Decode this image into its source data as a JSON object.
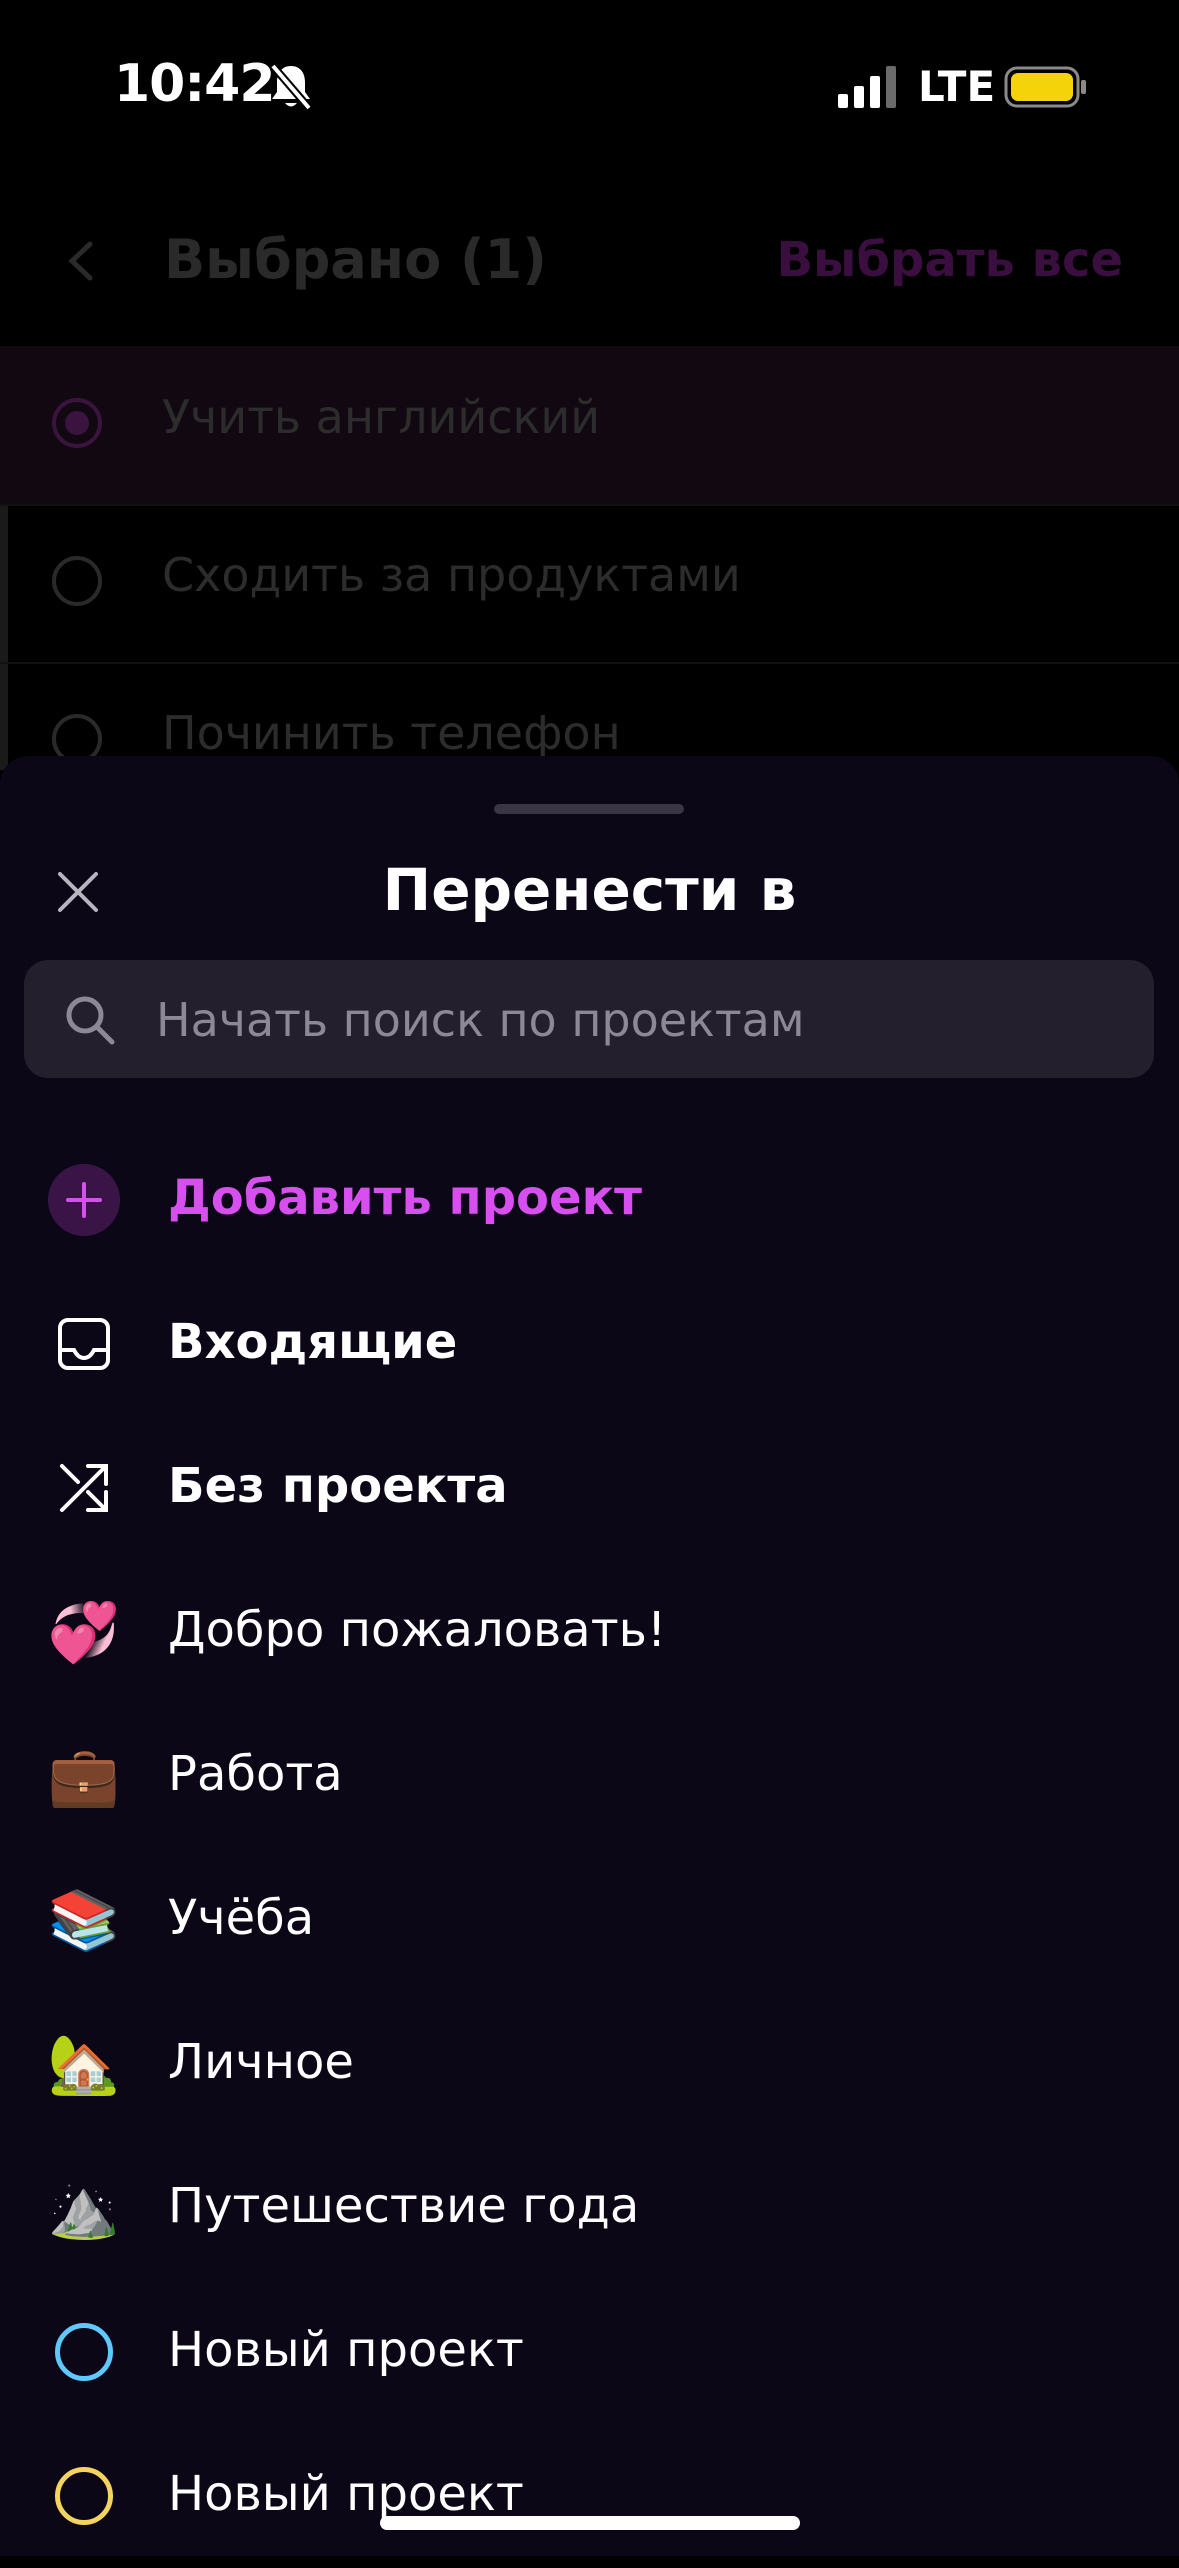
{
  "status_bar": {
    "time": "10:42",
    "network": "LTE",
    "icons": [
      "bell-slash-icon",
      "signal-icon",
      "battery-icon"
    ],
    "battery_color": "#f5d30a"
  },
  "background": {
    "title": "Выбрано (1)",
    "select_all": "Выбрать все",
    "tasks": [
      {
        "text": "Учить английский",
        "selected": true
      },
      {
        "text": "Сходить за продуктами",
        "selected": false
      },
      {
        "text": "Починить телефон",
        "selected": false
      }
    ]
  },
  "sheet": {
    "title": "Перенести в",
    "search": {
      "placeholder": "Начать поиск по проектам",
      "value": ""
    },
    "add_project": "Добавить проект",
    "items": [
      {
        "label": "Входящие",
        "icon": "inbox-icon"
      },
      {
        "label": "Без проекта",
        "icon": "shuffle-icon"
      },
      {
        "label": "Добро пожаловать!",
        "icon": "two-hearts-emoji",
        "emoji": "💞"
      },
      {
        "label": "Работа",
        "icon": "briefcase-emoji",
        "emoji": "💼"
      },
      {
        "label": "Учёба",
        "icon": "books-emoji",
        "emoji": "📚"
      },
      {
        "label": "Личное",
        "icon": "house-with-garden-emoji",
        "emoji": "🏡"
      },
      {
        "label": "Путешествие года",
        "icon": "mountain-emoji",
        "emoji": "⛰️"
      },
      {
        "label": "Новый проект",
        "icon": "blue-circle-icon"
      },
      {
        "label": "Новый проект",
        "icon": "yellow-circle-icon"
      }
    ]
  },
  "colors": {
    "accent": "#d84ff0",
    "sheet_bg": "#0b0716",
    "search_bg": "#231f2c",
    "ring_blue": "#5ec8ff",
    "ring_yellow": "#f4d35e"
  }
}
